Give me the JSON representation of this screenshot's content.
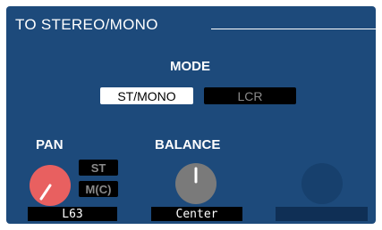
{
  "section": {
    "title": "TO STEREO/MONO"
  },
  "mode": {
    "label": "MODE",
    "options": [
      {
        "label": "ST/MONO",
        "selected": true
      },
      {
        "label": "LCR",
        "selected": false
      }
    ]
  },
  "pan": {
    "label": "PAN",
    "value": "L63",
    "knob_color": "#e86060",
    "buttons": {
      "st": "ST",
      "mc": "M(C)"
    }
  },
  "balance": {
    "label": "BALANCE",
    "value": "Center",
    "knob_color": "#7a7a7a"
  },
  "third_knob": {
    "value": ""
  },
  "colors": {
    "panel_bg": "#1d4a7b",
    "text": "#ffffff",
    "button_off_text": "#8a8a8a"
  }
}
